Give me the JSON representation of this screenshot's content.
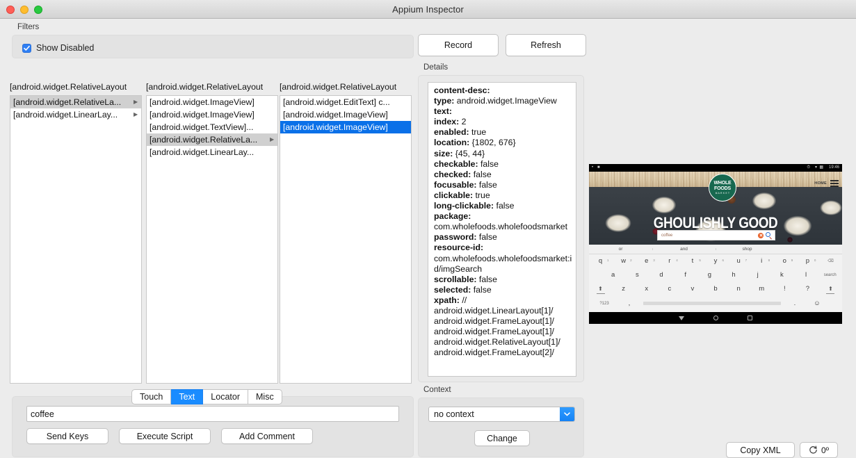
{
  "window": {
    "title": "Appium Inspector",
    "controls": [
      "close",
      "minimize",
      "maximize"
    ]
  },
  "filters": {
    "label": "Filters",
    "show_disabled_label": "Show Disabled",
    "show_disabled_checked": true
  },
  "tree": {
    "columns": [
      {
        "header": "[android.widget.RelativeLayout",
        "items": [
          {
            "label": "[android.widget.RelativeLa...",
            "expandable": true,
            "state": "selected-inactive"
          },
          {
            "label": "[android.widget.LinearLay...",
            "expandable": true,
            "state": "normal"
          }
        ]
      },
      {
        "header": "[android.widget.RelativeLayout",
        "items": [
          {
            "label": "[android.widget.ImageView]",
            "expandable": false,
            "state": "normal"
          },
          {
            "label": "[android.widget.ImageView]",
            "expandable": false,
            "state": "normal"
          },
          {
            "label": "[android.widget.TextView]...",
            "expandable": false,
            "state": "normal"
          },
          {
            "label": "[android.widget.RelativeLa...",
            "expandable": true,
            "state": "selected-inactive"
          },
          {
            "label": "[android.widget.LinearLay...",
            "expandable": false,
            "state": "normal"
          }
        ]
      },
      {
        "header": "[android.widget.RelativeLayout",
        "items": [
          {
            "label": "[android.widget.EditText] c...",
            "expandable": false,
            "state": "normal"
          },
          {
            "label": "[android.widget.ImageView]",
            "expandable": false,
            "state": "normal"
          },
          {
            "label": "[android.widget.ImageView]",
            "expandable": false,
            "state": "selected-active"
          }
        ]
      }
    ]
  },
  "toolbar": {
    "record_label": "Record",
    "refresh_label": "Refresh"
  },
  "details": {
    "label": "Details",
    "rows": [
      {
        "key": "content-desc:",
        "value": ""
      },
      {
        "key": "type:",
        "value": " android.widget.ImageView"
      },
      {
        "key": "text:",
        "value": ""
      },
      {
        "key": "index:",
        "value": " 2"
      },
      {
        "key": "enabled:",
        "value": " true"
      },
      {
        "key": "location:",
        "value": " {1802, 676}"
      },
      {
        "key": "size:",
        "value": " {45, 44}"
      },
      {
        "key": "checkable:",
        "value": " false"
      },
      {
        "key": "checked:",
        "value": " false"
      },
      {
        "key": "focusable:",
        "value": " false"
      },
      {
        "key": "clickable:",
        "value": " true"
      },
      {
        "key": "long-clickable:",
        "value": " false"
      },
      {
        "key": "package:",
        "value": ""
      },
      {
        "key": "",
        "value": "com.wholefoods.wholefoodsmarket"
      },
      {
        "key": "password:",
        "value": " false"
      },
      {
        "key": "resource-id:",
        "value": ""
      },
      {
        "key": "",
        "value": "com.wholefoods.wholefoodsmarket:id/imgSearch"
      },
      {
        "key": "scrollable:",
        "value": " false"
      },
      {
        "key": "selected:",
        "value": " false"
      },
      {
        "key": "xpath:",
        "value": " //"
      },
      {
        "key": "",
        "value": "android.widget.LinearLayout[1]/"
      },
      {
        "key": "",
        "value": "android.widget.FrameLayout[1]/"
      },
      {
        "key": "",
        "value": "android.widget.FrameLayout[1]/"
      },
      {
        "key": "",
        "value": "android.widget.RelativeLayout[1]/"
      },
      {
        "key": "",
        "value": "android.widget.FrameLayout[2]/"
      }
    ]
  },
  "tabs": {
    "items": [
      {
        "label": "Touch",
        "active": false
      },
      {
        "label": "Text",
        "active": true
      },
      {
        "label": "Locator",
        "active": false
      },
      {
        "label": "Misc",
        "active": false
      }
    ]
  },
  "text_panel": {
    "input_value": "coffee",
    "input_placeholder": "",
    "send_keys_label": "Send Keys",
    "execute_script_label": "Execute Script",
    "add_comment_label": "Add Comment"
  },
  "context": {
    "label": "Context",
    "selected": "no context",
    "options": [
      "no context"
    ],
    "change_label": "Change"
  },
  "screenshot_actions": {
    "copy_xml_label": "Copy XML",
    "rotation_label": "0º"
  },
  "phone": {
    "brand_line1": "WHOLE",
    "brand_line2": "FOODS",
    "brand_line3": "M A R K E T",
    "nav_home_label": "HOME",
    "headline": "GHOULISHLY GOOD",
    "search_value": "coffee",
    "suggestions": [
      "or",
      "and",
      "shop"
    ],
    "keyboard": {
      "row1": [
        {
          "key": "q",
          "num": "1"
        },
        {
          "key": "w",
          "num": "2"
        },
        {
          "key": "e",
          "num": "3"
        },
        {
          "key": "r",
          "num": "4"
        },
        {
          "key": "t",
          "num": "5"
        },
        {
          "key": "y",
          "num": "6"
        },
        {
          "key": "u",
          "num": "7"
        },
        {
          "key": "i",
          "num": "8"
        },
        {
          "key": "o",
          "num": "9"
        },
        {
          "key": "p",
          "num": "0"
        },
        {
          "key": "⌫",
          "num": ""
        }
      ],
      "row2": [
        {
          "key": "a"
        },
        {
          "key": "s"
        },
        {
          "key": "d"
        },
        {
          "key": "f"
        },
        {
          "key": "g"
        },
        {
          "key": "h"
        },
        {
          "key": "j"
        },
        {
          "key": "k"
        },
        {
          "key": "l"
        },
        {
          "key": "search"
        }
      ],
      "row3": [
        {
          "key": "⬆"
        },
        {
          "key": "z"
        },
        {
          "key": "x"
        },
        {
          "key": "c"
        },
        {
          "key": "v"
        },
        {
          "key": "b"
        },
        {
          "key": "n"
        },
        {
          "key": "m"
        },
        {
          "key": "!"
        },
        {
          "key": "?"
        },
        {
          "key": "⬆"
        }
      ],
      "row4": [
        {
          "key": "?123"
        },
        {
          "key": ","
        },
        {
          "key": "space"
        },
        {
          "key": "."
        },
        {
          "key": "☺"
        }
      ]
    }
  }
}
